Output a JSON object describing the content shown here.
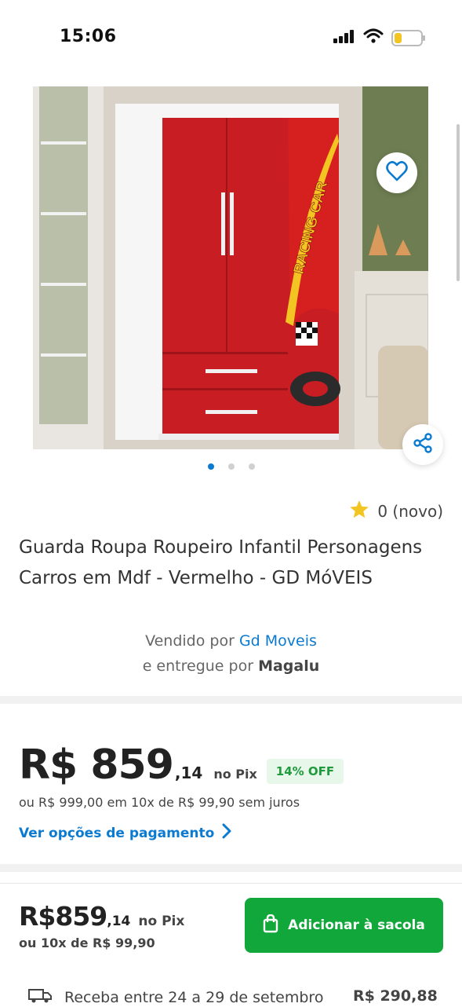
{
  "status_bar": {
    "time": "15:06"
  },
  "product": {
    "rating_value": "0 (novo)",
    "title": "Guarda Roupa Roupeiro Infantil Personagens Carros em Mdf - Vermelho - GD MóVEIS",
    "sold_by_prefix": "Vendido por",
    "seller_name": "Gd Moveis",
    "delivered_by_prefix": "e entregue por",
    "delivery_company": "Magalu",
    "image_decal_text": "RACING CAR",
    "carousel": {
      "total": 3,
      "active": 1
    }
  },
  "price": {
    "integer": "R$ 859",
    "cents": ",14",
    "method": "no Pix",
    "discount_badge": "14% OFF",
    "installments": "ou R$ 999,00 em 10x de R$ 99,90 sem juros",
    "payment_options_link": "Ver opções de pagamento"
  },
  "bottom_bar": {
    "price_integer": "R$859",
    "price_cents": ",14",
    "method": "no Pix",
    "installments": "ou 10x de R$ 99,90",
    "add_button": "Adicionar à sacola",
    "delivery_text": "Receba entre 24 a 29 de setembro",
    "delivery_price": "R$ 290,88"
  },
  "icons": {
    "favorite": "heart-icon",
    "share": "share-icon",
    "rating": "star-icon",
    "add": "shopping-bag-icon",
    "delivery": "truck-icon",
    "chevron": "chevron-right-icon"
  },
  "colors": {
    "brand_blue": "#0b7ad1",
    "add_button_green": "#11a73b",
    "discount_green": "#1f9a3c",
    "star_yellow": "#f2c522"
  }
}
